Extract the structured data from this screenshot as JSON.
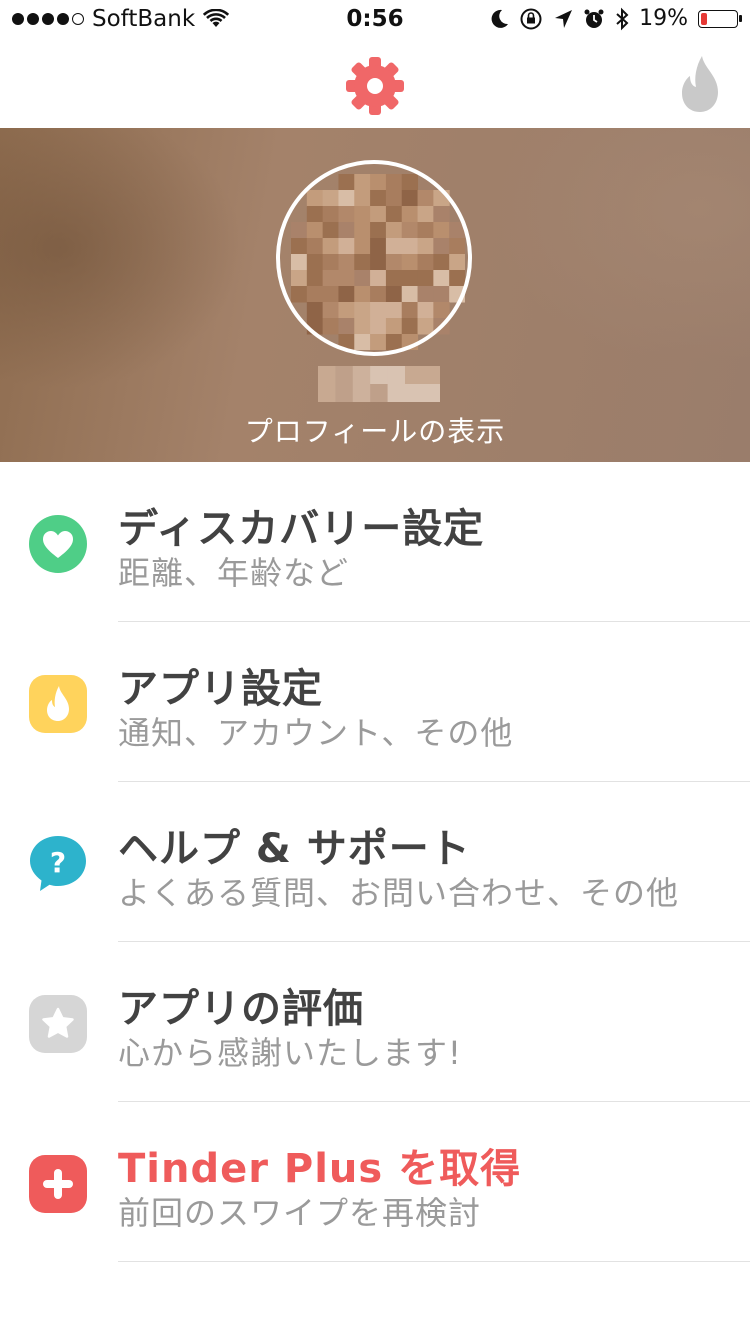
{
  "status_bar": {
    "carrier": "SoftBank",
    "time": "0:56",
    "battery": "19%",
    "battery_level": 0.19,
    "signal_bars": 4
  },
  "profile": {
    "view_profile_label": "プロフィールの表示"
  },
  "colors": {
    "accent": "#ef5b5b",
    "green": "#4fce87",
    "yellow": "#ffd35c",
    "teal": "#2db3cc",
    "gray": "#d6d6d6"
  },
  "menu": {
    "items": [
      {
        "title": "ディスカバリー設定",
        "subtitle": "距離、年齢など",
        "icon": "heart-icon"
      },
      {
        "title": "アプリ設定",
        "subtitle": "通知、アカウント、その他",
        "icon": "flame-icon"
      },
      {
        "title": "ヘルプ & サポート",
        "subtitle": "よくある質問、お問い合わせ、その他",
        "icon": "help-icon"
      },
      {
        "title": "アプリの評価",
        "subtitle": "心から感謝いたします!",
        "icon": "star-icon"
      },
      {
        "title": "Tinder Plus を取得",
        "subtitle": "前回のスワイプを再検討",
        "icon": "plus-icon"
      }
    ]
  }
}
